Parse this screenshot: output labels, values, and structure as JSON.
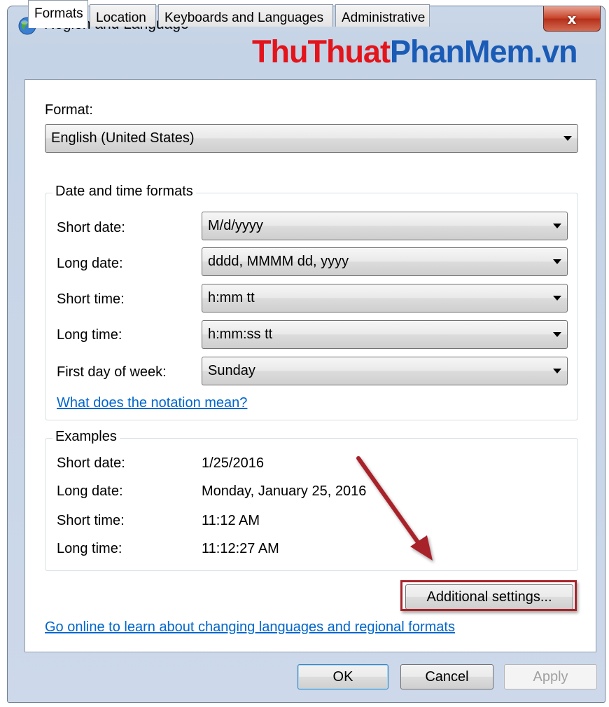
{
  "window": {
    "title": "Region and Language",
    "close_glyph": "x",
    "icon": "globe-icon"
  },
  "watermark": {
    "part1": "ThuThuat",
    "part2": "PhanMem",
    "part3": ".vn"
  },
  "tabs": [
    {
      "label": "Formats",
      "active": true
    },
    {
      "label": "Location",
      "active": false
    },
    {
      "label": "Keyboards and Languages",
      "active": false
    },
    {
      "label": "Administrative",
      "active": false
    }
  ],
  "format": {
    "label": "Format:",
    "value": "English (United States)"
  },
  "date_time_formats": {
    "title": "Date and time formats",
    "rows": [
      {
        "label": "Short date:",
        "value": "M/d/yyyy"
      },
      {
        "label": "Long date:",
        "value": "dddd, MMMM dd, yyyy"
      },
      {
        "label": "Short time:",
        "value": "h:mm tt"
      },
      {
        "label": "Long time:",
        "value": "h:mm:ss tt"
      },
      {
        "label": "First day of week:",
        "value": "Sunday"
      }
    ],
    "notation_link": "What does the notation mean?"
  },
  "examples": {
    "title": "Examples",
    "rows": [
      {
        "label": "Short date:",
        "value": "1/25/2016"
      },
      {
        "label": "Long date:",
        "value": "Monday, January 25, 2016"
      },
      {
        "label": "Short time:",
        "value": "11:12 AM"
      },
      {
        "label": "Long time:",
        "value": "11:12:27 AM"
      }
    ]
  },
  "additional_settings_label": "Additional settings...",
  "online_link": "Go online to learn about changing languages and regional formats",
  "buttons": {
    "ok": "OK",
    "cancel": "Cancel",
    "apply": "Apply"
  },
  "colors": {
    "annotation_red": "#a8242a",
    "link_blue": "#0066cc",
    "close_red": "#c7442b"
  }
}
